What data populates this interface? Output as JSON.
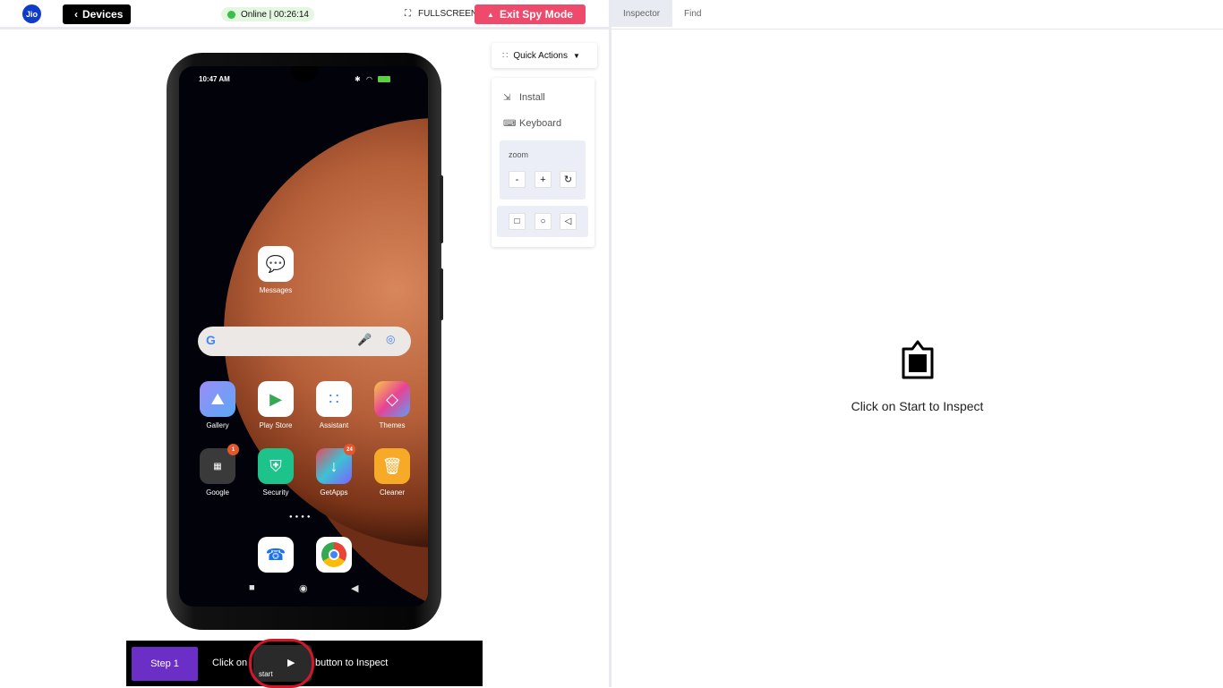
{
  "header": {
    "logo_text": "Jio",
    "devices_label": "Devices",
    "status_label": "Online | 00:26:14",
    "fullscreen_label": "FULLSCREEN",
    "exit_label": "Exit Spy Mode"
  },
  "phone": {
    "time": "10:47 AM",
    "battery": "100",
    "apps": {
      "messages": "Messages",
      "gallery": "Gallery",
      "play_store": "Play Store",
      "assistant": "Assistant",
      "themes": "Themes",
      "google": "Google",
      "security": "Security",
      "getapps": "GetApps",
      "cleaner": "Cleaner"
    },
    "badges": {
      "google": "1",
      "getapps": "24"
    }
  },
  "quick_actions": {
    "title": "Quick Actions",
    "install": "Install",
    "keyboard": "Keyboard",
    "zoom_label": "zoom",
    "zoom_out": "-",
    "zoom_in": "+"
  },
  "step": {
    "step_label": "Step 1",
    "text_before": "Click on",
    "start_label": "start",
    "text_after": "button to Inspect"
  },
  "inspector": {
    "tabs": [
      "Inspector",
      "Find"
    ],
    "empty_message": "Click on Start to Inspect"
  },
  "colors": {
    "exit_button": "#ee4a6c",
    "step_button": "#6b2fc7",
    "status_dot": "#37c145",
    "highlight_ring": "#d1182b"
  }
}
